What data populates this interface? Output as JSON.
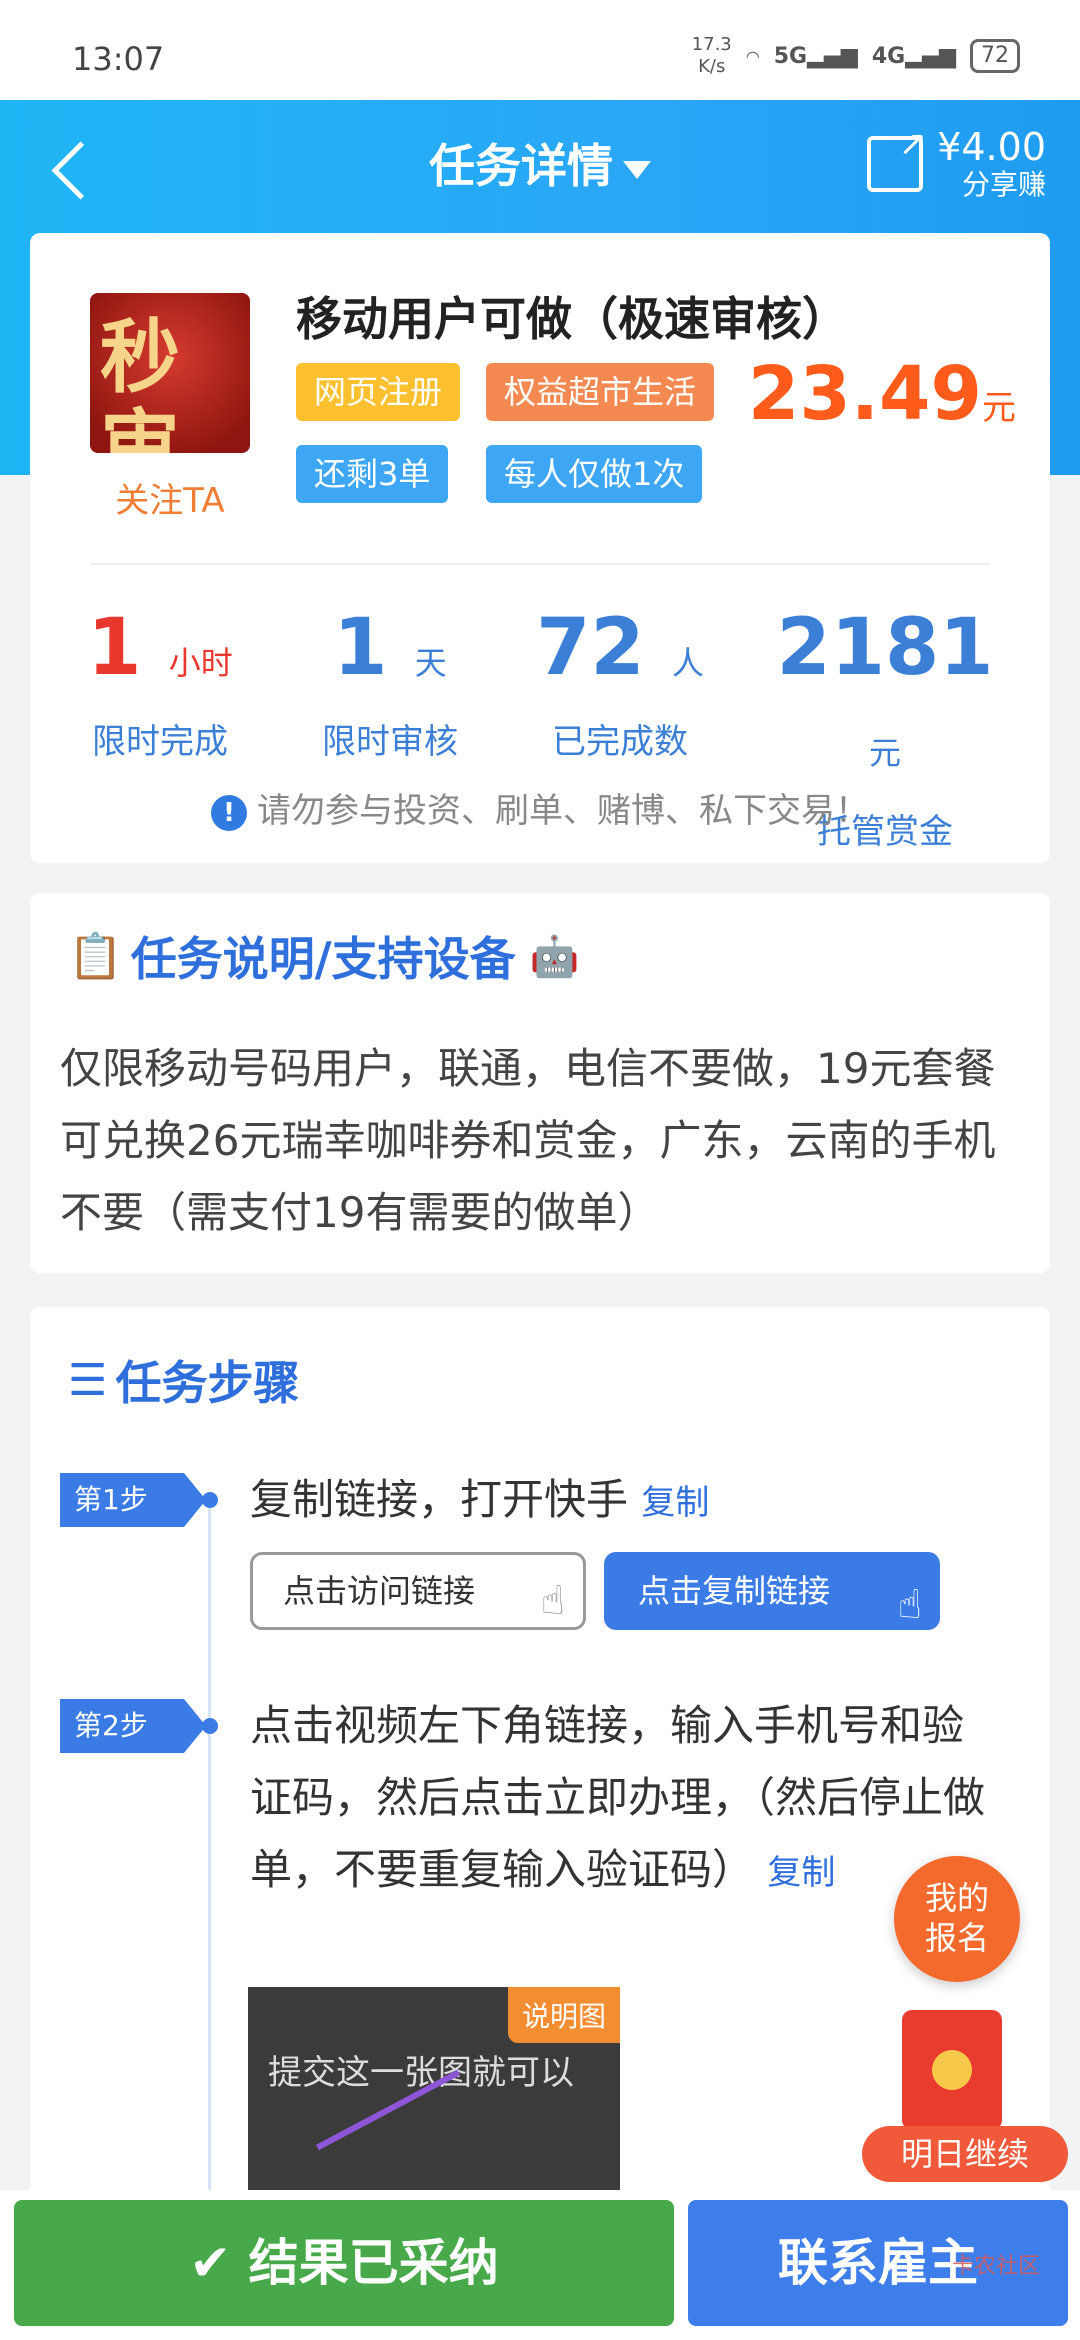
{
  "status_bar": {
    "time": "13:07",
    "net_speed_value": "17.3",
    "net_speed_unit": "K/s",
    "signal1": "5G",
    "signal2": "4G",
    "battery": "72"
  },
  "header": {
    "title": "任务详情",
    "share_amount": "¥4.00",
    "share_label": "分享赚"
  },
  "task": {
    "logo_text": "秒审",
    "follow_label": "关注TA",
    "title": "移动用户可做（极速审核）",
    "tags": [
      "网页注册",
      "权益超市生活",
      "还剩3单",
      "每人仅做1次"
    ],
    "price": "23.49",
    "price_unit": "元",
    "stats": [
      {
        "value": "1",
        "unit": "小时",
        "label": "限时完成",
        "color": "#e8372c"
      },
      {
        "value": "1",
        "unit": "天",
        "label": "限时审核",
        "color": "#3c7fd6"
      },
      {
        "value": "72",
        "unit": "人",
        "label": "已完成数",
        "color": "#3c7fd6"
      },
      {
        "value": "2181",
        "unit": "元",
        "label": "托管赏金",
        "color": "#3c7fd6"
      }
    ],
    "warning": "请勿参与投资、刷单、赌博、私下交易！"
  },
  "description": {
    "title": "任务说明/支持设备",
    "text": "仅限移动号码用户，联通，电信不要做，19元套餐可兑换26元瑞幸咖啡券和赏金，广东，云南的手机不要（需支付19有需要的做单）"
  },
  "steps": {
    "title": "任务步骤",
    "items": [
      {
        "badge": "第1步",
        "text": "复制链接，打开快手",
        "copy": "复制"
      },
      {
        "badge": "第2步",
        "text": "点击视频左下角链接，输入手机号和验证码，然后点击立即办理，（然后停止做单，不要重复输入验证码）",
        "copy": "复制"
      }
    ],
    "btn_visit": "点击访问链接",
    "btn_copy": "点击复制链接",
    "illus_tag": "说明图",
    "illus_text": "提交这一张图就可以"
  },
  "floats": {
    "signup": [
      "我的",
      "报名"
    ],
    "tomorrow": "明日继续"
  },
  "bottom": {
    "accepted": "结果已采纳",
    "contact": "联系雇主",
    "watermark": "卡农社区"
  },
  "colors": {
    "header": "#2aa6f7",
    "accent_blue": "#3a7be6",
    "price": "#ff5b1a",
    "accepted": "#47a94a"
  }
}
